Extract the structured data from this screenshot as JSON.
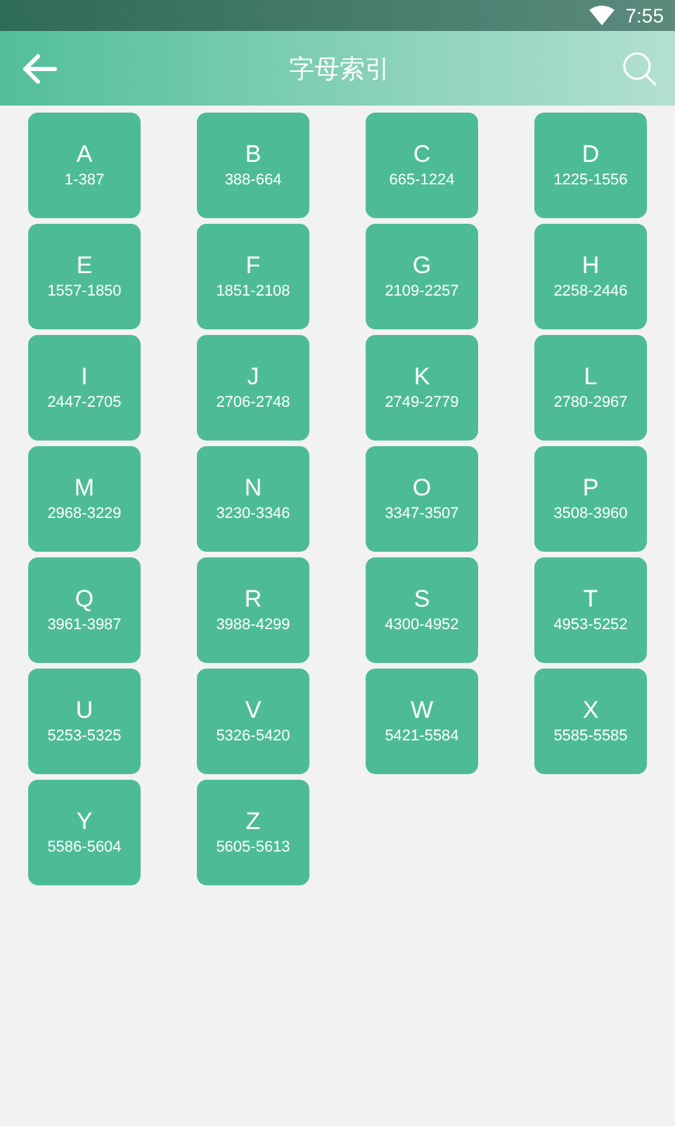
{
  "status_bar": {
    "time": "7:55"
  },
  "header": {
    "title": "字母索引"
  },
  "letters": [
    {
      "letter": "A",
      "range": "1-387"
    },
    {
      "letter": "B",
      "range": "388-664"
    },
    {
      "letter": "C",
      "range": "665-1224"
    },
    {
      "letter": "D",
      "range": "1225-1556"
    },
    {
      "letter": "E",
      "range": "1557-1850"
    },
    {
      "letter": "F",
      "range": "1851-2108"
    },
    {
      "letter": "G",
      "range": "2109-2257"
    },
    {
      "letter": "H",
      "range": "2258-2446"
    },
    {
      "letter": "I",
      "range": "2447-2705"
    },
    {
      "letter": "J",
      "range": "2706-2748"
    },
    {
      "letter": "K",
      "range": "2749-2779"
    },
    {
      "letter": "L",
      "range": "2780-2967"
    },
    {
      "letter": "M",
      "range": "2968-3229"
    },
    {
      "letter": "N",
      "range": "3230-3346"
    },
    {
      "letter": "O",
      "range": "3347-3507"
    },
    {
      "letter": "P",
      "range": "3508-3960"
    },
    {
      "letter": "Q",
      "range": "3961-3987"
    },
    {
      "letter": "R",
      "range": "3988-4299"
    },
    {
      "letter": "S",
      "range": "4300-4952"
    },
    {
      "letter": "T",
      "range": "4953-5252"
    },
    {
      "letter": "U",
      "range": "5253-5325"
    },
    {
      "letter": "V",
      "range": "5326-5420"
    },
    {
      "letter": "W",
      "range": "5421-5584"
    },
    {
      "letter": "X",
      "range": "5585-5585"
    },
    {
      "letter": "Y",
      "range": "5586-5604"
    },
    {
      "letter": "Z",
      "range": "5605-5613"
    }
  ]
}
